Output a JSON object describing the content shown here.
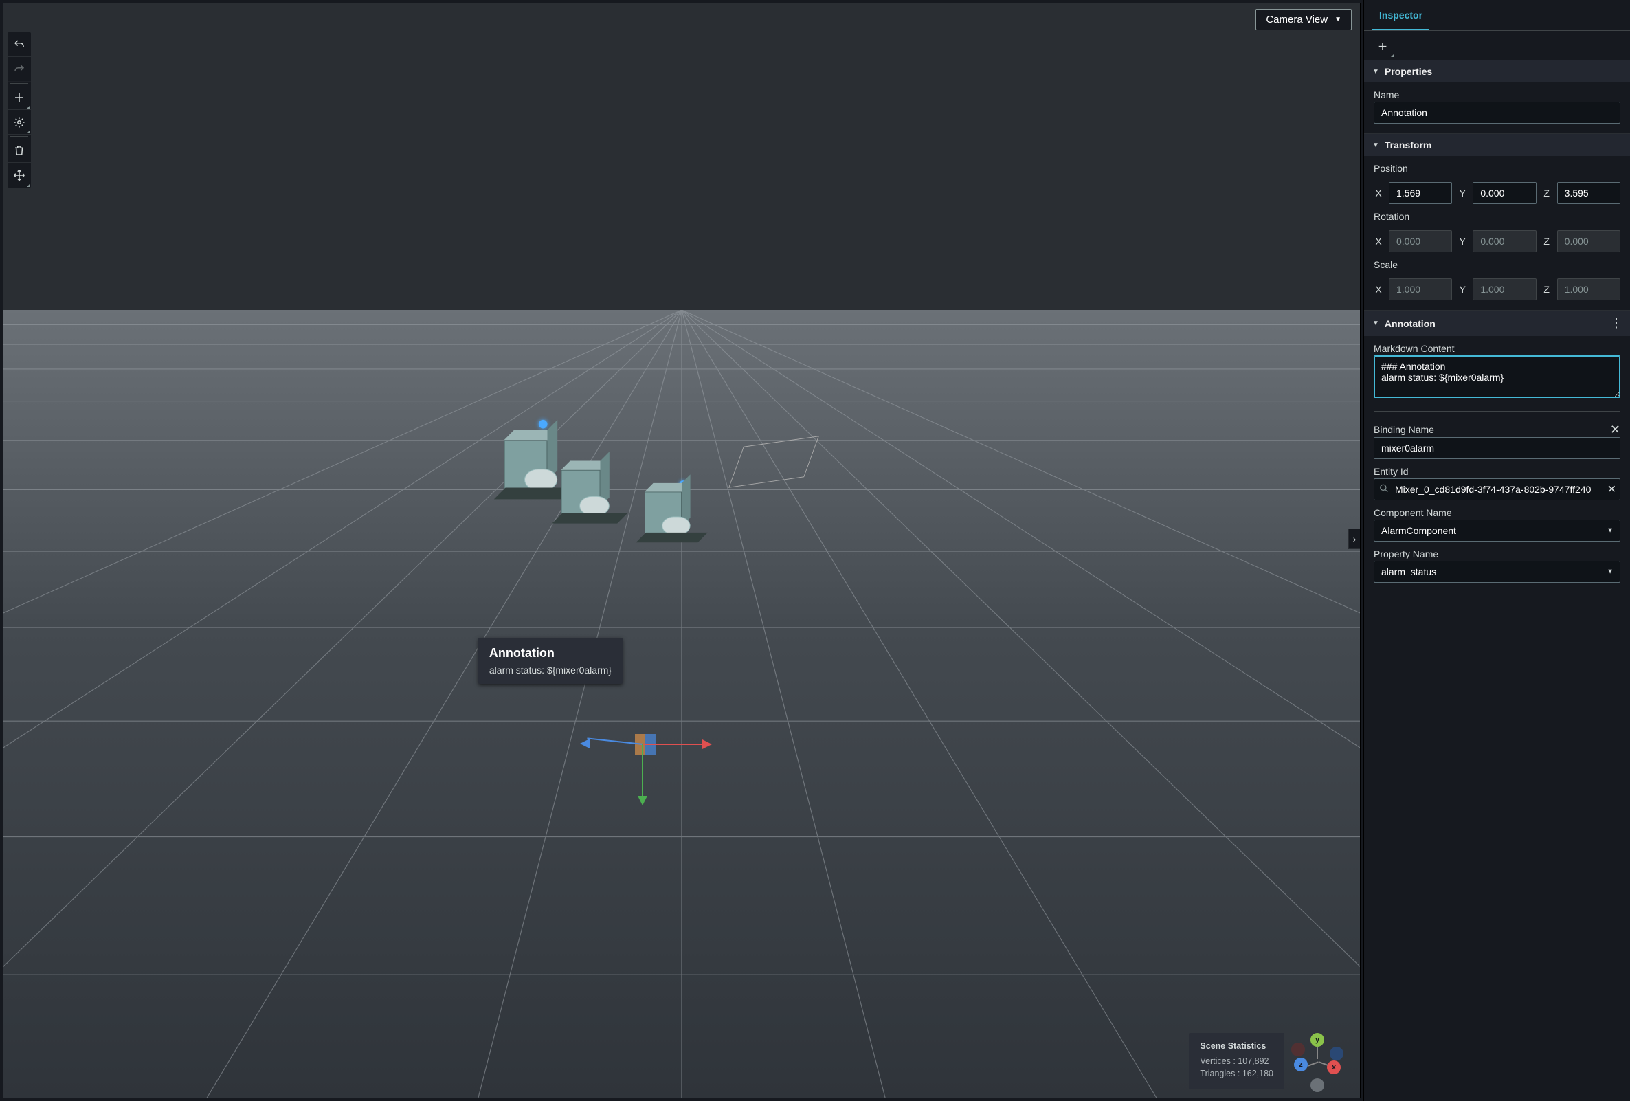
{
  "camera_button": {
    "label": "Camera View"
  },
  "toolbar": {
    "undo": "undo",
    "redo": "redo",
    "add": "add",
    "transform": "transform",
    "delete": "delete",
    "expand": "expand"
  },
  "annotation_overlay": {
    "title": "Annotation",
    "body": "alarm status: ${mixer0alarm}"
  },
  "scene_stats": {
    "heading": "Scene Statistics",
    "vertices_label": "Vertices :",
    "vertices_value": "107,892",
    "triangles_label": "Triangles :",
    "triangles_value": "162,180"
  },
  "axis_widget": {
    "x": "x",
    "y": "y",
    "z": "z"
  },
  "inspector": {
    "tab": "Inspector",
    "sections": {
      "properties": {
        "title": "Properties",
        "name_label": "Name",
        "name_value": "Annotation"
      },
      "transform": {
        "title": "Transform",
        "position_label": "Position",
        "position": {
          "x": "1.569",
          "y": "0.000",
          "z": "3.595"
        },
        "rotation_label": "Rotation",
        "rotation": {
          "x": "0.000",
          "y": "0.000",
          "z": "0.000"
        },
        "scale_label": "Scale",
        "scale": {
          "x": "1.000",
          "y": "1.000",
          "z": "1.000"
        },
        "axis_x": "X",
        "axis_y": "Y",
        "axis_z": "Z"
      },
      "annotation": {
        "title": "Annotation",
        "markdown_label": "Markdown Content",
        "markdown_value": "### Annotation\nalarm status: ${mixer0alarm}",
        "binding_label": "Binding Name",
        "binding_value": "mixer0alarm",
        "entity_label": "Entity Id",
        "entity_value": "Mixer_0_cd81d9fd-3f74-437a-802b-9747ff240",
        "component_label": "Component Name",
        "component_value": "AlarmComponent",
        "property_label": "Property Name",
        "property_value": "alarm_status"
      }
    }
  }
}
